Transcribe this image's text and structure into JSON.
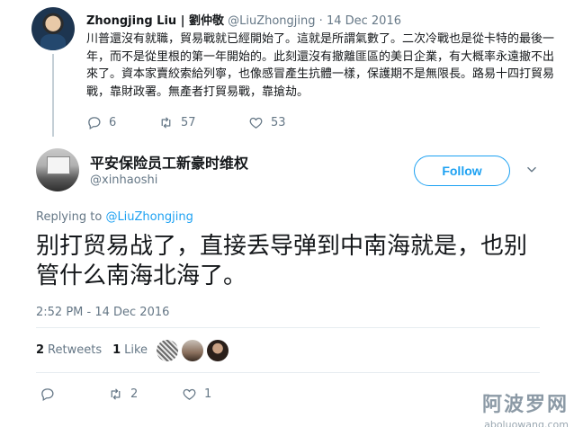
{
  "parent_tweet": {
    "author_name": "Zhongjing Liu | 劉仲敬",
    "author_handle": "@LiuZhongjing",
    "date_separator": "·",
    "date": "14 Dec 2016",
    "text": "川普還沒有就職，貿易戰就已經開始了。這就是所謂氣數了。二次冷戰也是從卡特的最後一年，而不是從里根的第一年開始的。此刻還沒有撤離匪區的美日企業，有大概率永遠撤不出來了。資本家賣絞索給列寧，也像感冒產生抗體一樣，保護期不是無限長。路易十四打貿易戰，靠財政署。無產者打貿易戰，靠搶劫。",
    "reply_count": "6",
    "retweet_count": "57",
    "like_count": "53"
  },
  "main_tweet": {
    "author_name": "平安保险员工新豪时维权",
    "author_handle": "@xinhaoshi",
    "follow_label": "Follow",
    "replying_prefix": "Replying to",
    "replying_to": "@LiuZhongjing",
    "text": "别打贸易战了，直接丢导弹到中南海就是，也别管什么南海北海了。",
    "timestamp": "2:52 PM - 14 Dec 2016",
    "retweets_count": "2",
    "retweets_label": "Retweets",
    "likes_count": "1",
    "likes_label": "Like",
    "action_retweet_count": "2",
    "action_like_count": "1"
  },
  "watermark": {
    "site_name": "阿波罗网",
    "url": "aboluowang.com"
  },
  "colors": {
    "accent": "#1da1f2",
    "secondary_text": "#657786",
    "primary_text": "#14171a",
    "divider": "#e6ecf0"
  },
  "icons": [
    "reply-icon",
    "retweet-icon",
    "heart-icon",
    "chevron-down-icon"
  ]
}
